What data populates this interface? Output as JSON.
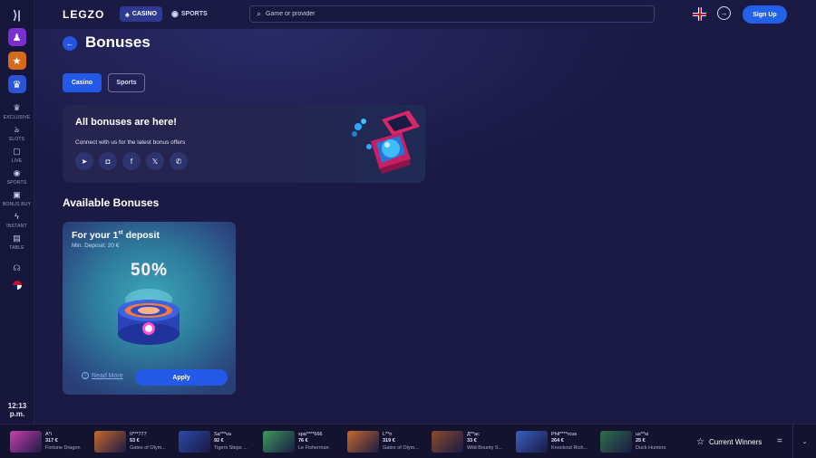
{
  "header": {
    "logo": "LEGZO",
    "casino_label": "CASINO",
    "sports_label": "SPORTS",
    "search_placeholder": "Game or provider",
    "signup_label": "Sign Up"
  },
  "sidebar": {
    "items": [
      {
        "label": "EXCLUSIVE",
        "icon": "crown-badge-icon",
        "glyph": "♛"
      },
      {
        "label": "SLOTS",
        "icon": "cherry-icon",
        "glyph": "ঌ"
      },
      {
        "label": "LIVE",
        "icon": "tv-icon",
        "glyph": "▢"
      },
      {
        "label": "SPORTS",
        "icon": "ball-icon",
        "glyph": "◉"
      },
      {
        "label": "BONUS BUY",
        "icon": "bonus-buy-icon",
        "glyph": "▣"
      },
      {
        "label": "INSTANT",
        "icon": "lightning-icon",
        "glyph": "ϟ"
      },
      {
        "label": "TABLE",
        "icon": "table-icon",
        "glyph": "▤"
      }
    ],
    "clock_time": "12:13",
    "clock_period": "p.m."
  },
  "page": {
    "title": "Bonuses",
    "tabs": [
      "Casino",
      "Sports"
    ]
  },
  "promo": {
    "title": "All bonuses are here!",
    "subtitle": "Connect with us for the latest bonus offers",
    "socials": [
      {
        "icon": "telegram-icon",
        "glyph": "➤"
      },
      {
        "icon": "instagram-icon",
        "glyph": "◘"
      },
      {
        "icon": "facebook-icon",
        "glyph": "f"
      },
      {
        "icon": "x-icon",
        "glyph": "𝕏"
      },
      {
        "icon": "whatsapp-icon",
        "glyph": "✆"
      }
    ]
  },
  "available": {
    "title": "Available Bonuses",
    "card": {
      "title_prefix": "For your 1",
      "title_sup": "st",
      "title_suffix": " deposit",
      "min_deposit": "Min. Deposit: 20 €",
      "percent": "50%",
      "read_more": "Read More",
      "apply": "Apply"
    }
  },
  "winners": {
    "label": "Current Winners",
    "items": [
      {
        "user": "A*i",
        "amount": "317 €",
        "game": "Fortune Dragon",
        "color": "#c93fae"
      },
      {
        "user": "II***777",
        "amount": "53 €",
        "game": "Gates of Olym...",
        "color": "#c76a2a"
      },
      {
        "user": "Sa***va",
        "amount": "92 €",
        "game": "Tigers Steps ...",
        "color": "#2b4aa8"
      },
      {
        "user": "spa****666",
        "amount": "76 €",
        "game": "Le Fisherman",
        "color": "#3f9a5a"
      },
      {
        "user": "L**n",
        "amount": "319 €",
        "game": "Gates of Olym...",
        "color": "#c76a2a"
      },
      {
        "user": "Д**ас",
        "amount": "33 €",
        "game": "Wild Bounty S...",
        "color": "#8a4b2a"
      },
      {
        "user": "Phil****rcus",
        "amount": "264 €",
        "game": "Knockout Rich...",
        "color": "#3a5fc0"
      },
      {
        "user": "us**si",
        "amount": "25 €",
        "game": "Duck Hunters",
        "color": "#2f6e4a"
      }
    ]
  }
}
